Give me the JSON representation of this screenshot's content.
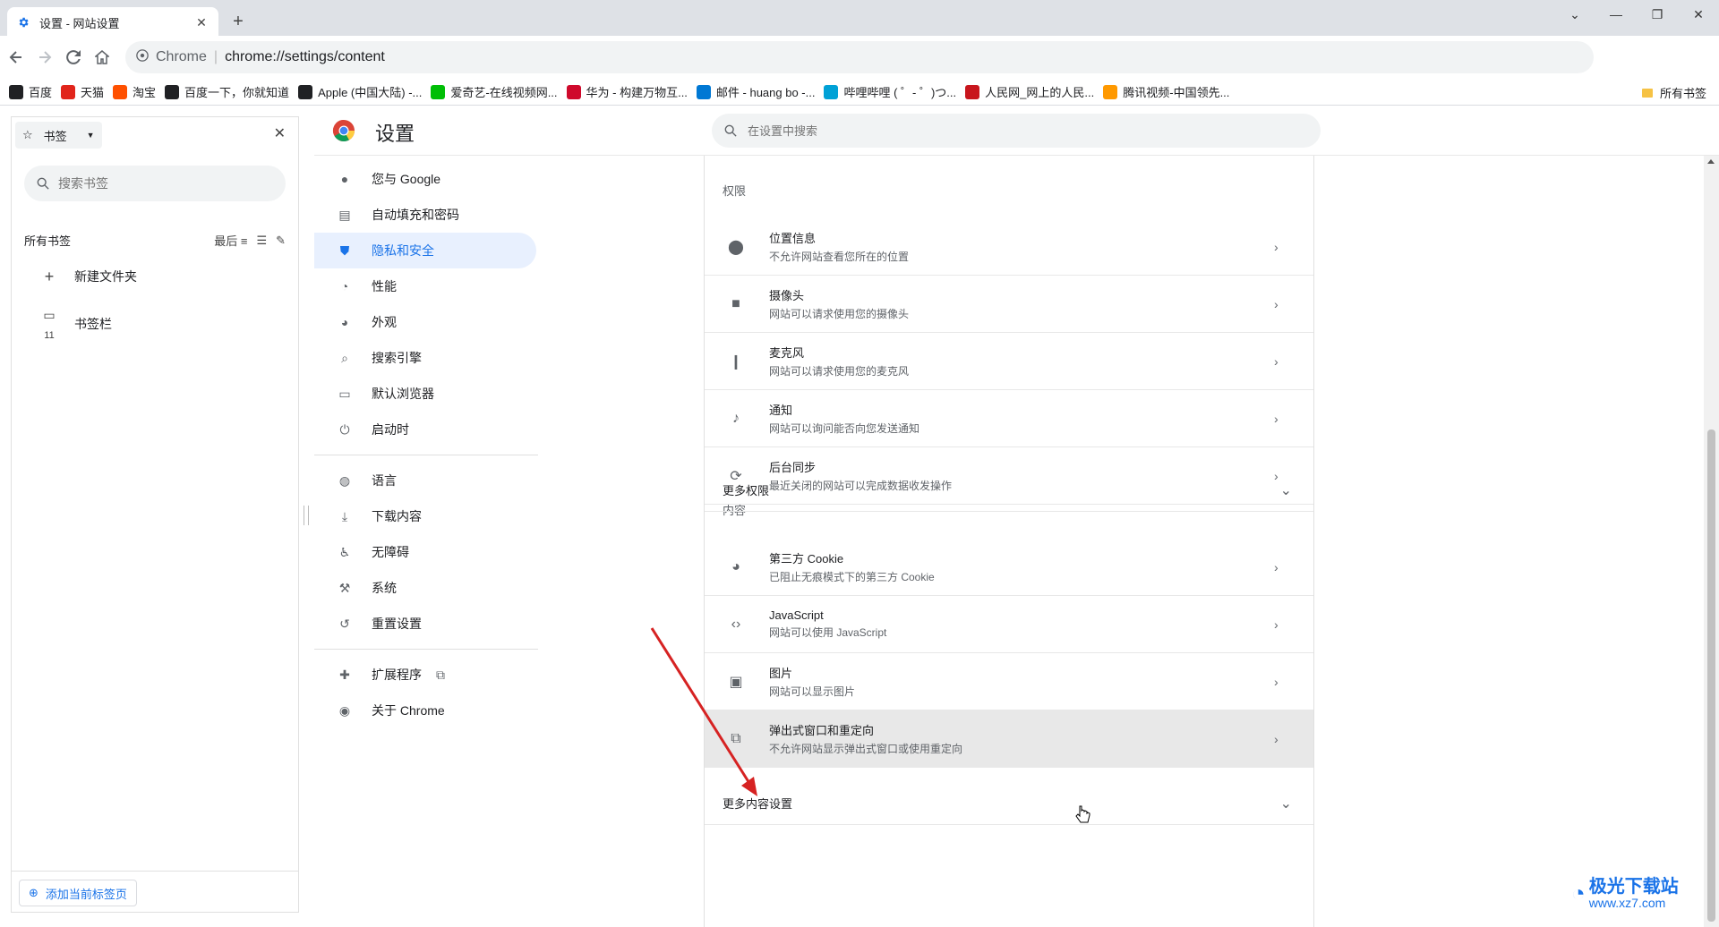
{
  "tab": {
    "title": "设置 - 网站设置",
    "close": "✕",
    "new": "+"
  },
  "window": {
    "minimize": "—",
    "restore": "❐",
    "close": "✕",
    "dropdown": "⌄"
  },
  "address": {
    "chip": "Chrome",
    "separator": "|",
    "url": "chrome://settings/content"
  },
  "bookmarks_bar": {
    "items": [
      {
        "label": "百度",
        "color": "#202124"
      },
      {
        "label": "天猫",
        "color": "#e1251b"
      },
      {
        "label": "淘宝",
        "color": "#ff5000"
      },
      {
        "label": "百度一下，你就知道",
        "color": "#202124"
      },
      {
        "label": "Apple (中国大陆) -...",
        "color": "#202124"
      },
      {
        "label": "爱奇艺-在线视频网...",
        "color": "#00be06"
      },
      {
        "label": "华为 - 构建万物互...",
        "color": "#cf0a2c"
      },
      {
        "label": "邮件 - huang bo -...",
        "color": "#0078d4"
      },
      {
        "label": "哔哩哔哩 ( ゜- ゜)つ...",
        "color": "#00a1d6"
      },
      {
        "label": "人民网_网上的人民...",
        "color": "#c8161d"
      },
      {
        "label": "腾讯视频-中国领先...",
        "color": "#ff9900"
      }
    ],
    "all_label": "所有书签"
  },
  "side_panel": {
    "selector": "书签",
    "search_placeholder": "搜索书签",
    "all_bookmarks": "所有书签",
    "sort_label": "最后",
    "new_folder": "新建文件夹",
    "bookmarks_bar": "书签栏",
    "bookmarks_bar_count": "11",
    "add_current": "添加当前标签页"
  },
  "settings": {
    "title": "设置",
    "search_placeholder": "在设置中搜索",
    "nav": [
      {
        "label": "您与 Google",
        "icon": "person-icon"
      },
      {
        "label": "自动填充和密码",
        "icon": "clipboard-icon"
      },
      {
        "label": "隐私和安全",
        "icon": "shield-icon"
      },
      {
        "label": "性能",
        "icon": "speedometer-icon"
      },
      {
        "label": "外观",
        "icon": "palette-icon"
      },
      {
        "label": "搜索引擎",
        "icon": "search-icon"
      },
      {
        "label": "默认浏览器",
        "icon": "browser-icon"
      },
      {
        "label": "启动时",
        "icon": "power-icon"
      },
      {
        "label": "语言",
        "icon": "globe-icon"
      },
      {
        "label": "下载内容",
        "icon": "download-icon"
      },
      {
        "label": "无障碍",
        "icon": "accessibility-icon"
      },
      {
        "label": "系统",
        "icon": "wrench-icon"
      },
      {
        "label": "重置设置",
        "icon": "history-icon"
      },
      {
        "label": "扩展程序",
        "icon": "puzzle-icon"
      },
      {
        "label": "关于 Chrome",
        "icon": "chrome-icon"
      }
    ],
    "permissions_title": "权限",
    "permissions": [
      {
        "title": "位置信息",
        "desc": "不允许网站查看您所在的位置",
        "icon": "location-icon"
      },
      {
        "title": "摄像头",
        "desc": "网站可以请求使用您的摄像头",
        "icon": "camera-icon"
      },
      {
        "title": "麦克风",
        "desc": "网站可以请求使用您的麦克风",
        "icon": "microphone-icon"
      },
      {
        "title": "通知",
        "desc": "网站可以询问能否向您发送通知",
        "icon": "bell-icon"
      },
      {
        "title": "后台同步",
        "desc": "最近关闭的网站可以完成数据收发操作",
        "icon": "sync-icon"
      }
    ],
    "more_permissions": "更多权限",
    "content_title": "内容",
    "content": [
      {
        "title": "第三方 Cookie",
        "desc": "已阻止无痕模式下的第三方 Cookie",
        "icon": "cookie-icon"
      },
      {
        "title": "JavaScript",
        "desc": "网站可以使用 JavaScript",
        "icon": "code-icon"
      },
      {
        "title": "图片",
        "desc": "网站可以显示图片",
        "icon": "image-icon"
      },
      {
        "title": "弹出式窗口和重定向",
        "desc": "不允许网站显示弹出式窗口或使用重定向",
        "icon": "open-in-new-icon"
      }
    ],
    "more_content": "更多内容设置"
  },
  "watermark": {
    "text": "极光下载站",
    "url": "www.xz7.com"
  },
  "colors": {
    "accent": "#1a73e8",
    "active_nav_bg": "#e8f0fe",
    "arrow": "#d62222"
  }
}
